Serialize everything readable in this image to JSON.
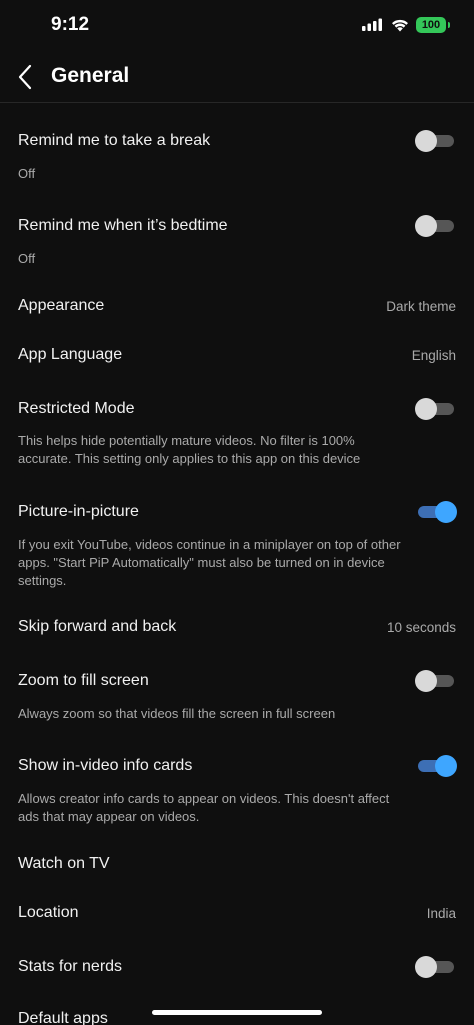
{
  "status_bar": {
    "time": "9:12",
    "battery": "100",
    "icons": [
      "signal-icon",
      "wifi-icon",
      "battery-icon"
    ]
  },
  "header": {
    "back_icon": "chevron-left-icon",
    "title": "General"
  },
  "settings": {
    "take_break": {
      "title": "Remind me to take a break",
      "subtitle": "Off",
      "enabled": false
    },
    "bedtime": {
      "title": "Remind me when it’s bedtime",
      "subtitle": "Off",
      "enabled": false
    },
    "appearance": {
      "title": "Appearance",
      "value": "Dark theme"
    },
    "app_language": {
      "title": "App Language",
      "value": "English"
    },
    "restricted_mode": {
      "title": "Restricted Mode",
      "description": "This helps hide potentially mature videos. No filter is 100% accurate. This setting only applies to this app on this device",
      "enabled": false
    },
    "pip": {
      "title": "Picture-in-picture",
      "description": "If you exit YouTube, videos continue in a miniplayer on top of other apps. \"Start PiP Automatically\" must also be turned on in device settings.",
      "enabled": true
    },
    "skip": {
      "title": "Skip forward and back",
      "value": "10 seconds"
    },
    "zoom": {
      "title": "Zoom to fill screen",
      "description": "Always zoom so that videos fill the screen in full screen",
      "enabled": false
    },
    "info_cards": {
      "title": "Show in-video info cards",
      "description": "Allows creator info cards to appear on videos. This doesn't affect ads that may appear on videos.",
      "enabled": true
    },
    "watch_tv": {
      "title": "Watch on TV"
    },
    "location": {
      "title": "Location",
      "value": "India"
    },
    "stats": {
      "title": "Stats for nerds",
      "enabled": false
    },
    "default_apps": {
      "title": "Default apps"
    }
  },
  "colors": {
    "background": "#0f0f0f",
    "toggle_on": "#3ea6ff",
    "toggle_off": "#d9d9d9",
    "battery": "#34c759"
  }
}
